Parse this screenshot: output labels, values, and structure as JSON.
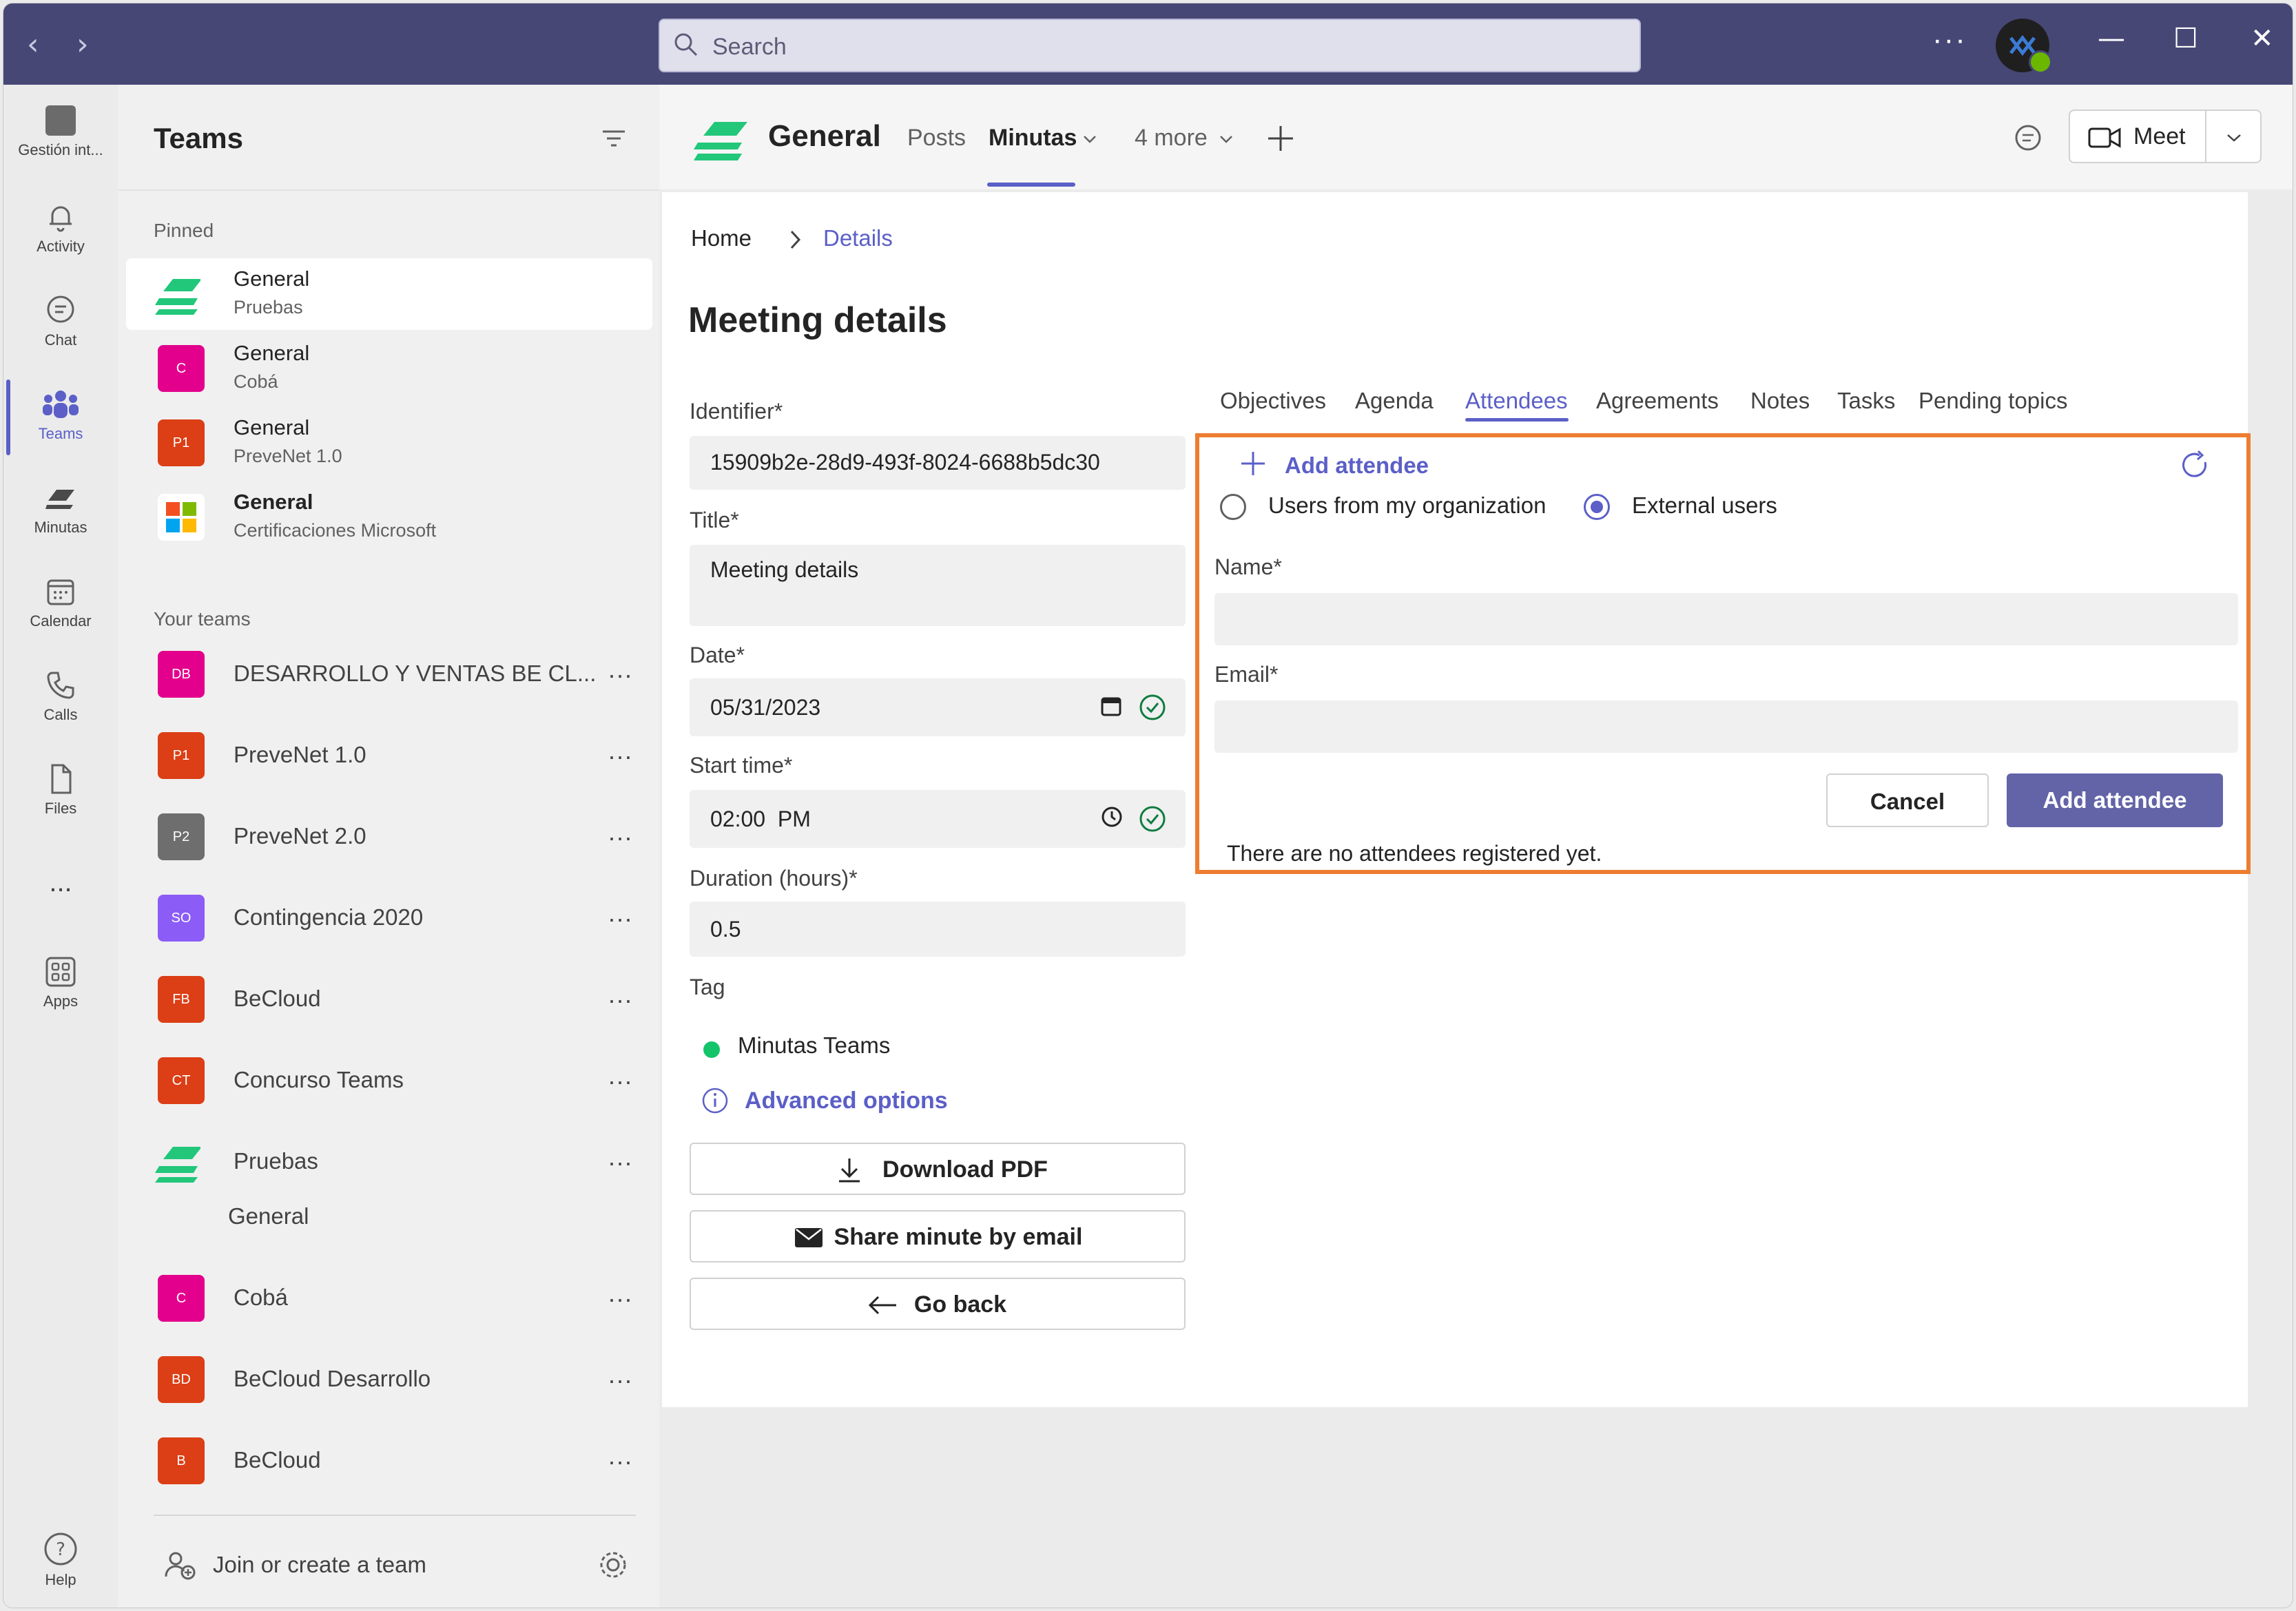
{
  "search": {
    "placeholder": "Search"
  },
  "rail": {
    "items": [
      {
        "label": "Gestión int..."
      },
      {
        "label": "Activity"
      },
      {
        "label": "Chat"
      },
      {
        "label": "Teams"
      },
      {
        "label": "Minutas"
      },
      {
        "label": "Calendar"
      },
      {
        "label": "Calls"
      },
      {
        "label": "Files"
      },
      {
        "label": "Apps"
      },
      {
        "label": "Help"
      }
    ],
    "more": "..."
  },
  "teams_panel": {
    "title": "Teams",
    "pinned_label": "Pinned",
    "pinned": [
      {
        "title": "General",
        "subtitle": "Pruebas",
        "icon": "minutas-logo",
        "selected": true
      },
      {
        "title": "General",
        "subtitle": "Cobá",
        "tile": "C",
        "color": "#e3008c"
      },
      {
        "title": "General",
        "subtitle": "PreveNet 1.0",
        "tile": "P1",
        "color": "#dc3e15"
      },
      {
        "title": "General",
        "subtitle": "Certificaciones Microsoft",
        "icon": "microsoft-logo"
      }
    ],
    "your_teams_label": "Your teams",
    "teams": [
      {
        "name": "DESARROLLO Y VENTAS BE CL...",
        "tile": "DB",
        "color": "#e3008c"
      },
      {
        "name": "PreveNet 1.0",
        "tile": "P1",
        "color": "#dc3e15"
      },
      {
        "name": "PreveNet 2.0",
        "tile": "P2",
        "color": "#6e6e6e"
      },
      {
        "name": "Contingencia 2020",
        "tile": "SO",
        "color": "#8b5cf6"
      },
      {
        "name": "BeCloud",
        "tile": "FB",
        "color": "#dc3e15"
      },
      {
        "name": "Concurso Teams",
        "tile": "CT",
        "color": "#dc3e15"
      },
      {
        "name": "Pruebas",
        "icon": "minutas-logo"
      },
      {
        "name": "Cobá",
        "tile": "C",
        "color": "#e3008c"
      },
      {
        "name": "BeCloud Desarrollo",
        "tile": "BD",
        "color": "#dc3e15"
      },
      {
        "name": "BeCloud",
        "tile": "B",
        "color": "#dc3e15"
      }
    ],
    "sub_channel": "General",
    "more_label": "...",
    "join_label": "Join or create a team"
  },
  "header": {
    "channel": "General",
    "tabs": [
      {
        "label": "Posts"
      },
      {
        "label": "Minutas"
      },
      {
        "label": "4 more"
      }
    ],
    "meet_label": "Meet"
  },
  "page": {
    "breadcrumb": {
      "home": "Home",
      "current": "Details"
    },
    "title": "Meeting details",
    "fields": {
      "identifier_label": "Identifier*",
      "identifier_value": "15909b2e-28d9-493f-8024-6688b5dc30",
      "title_label": "Title*",
      "title_value": "Meeting details",
      "date_label": "Date*",
      "date_value": "05/31/2023",
      "start_label": "Start time*",
      "start_value": "02:00  PM",
      "duration_label": "Duration (hours)*",
      "duration_value": "0.5",
      "tag_label": "Tag",
      "tag_value": "Minutas Teams"
    },
    "advanced_options": "Advanced options",
    "buttons": {
      "download": "Download PDF",
      "share": "Share minute by email",
      "back": "Go back"
    },
    "detail_tabs": [
      "Objectives",
      "Agenda",
      "Attendees",
      "Agreements",
      "Notes",
      "Tasks",
      "Pending topics"
    ],
    "attendees": {
      "add_link": "Add attendee",
      "radio_org": "Users from my organization",
      "radio_ext": "External users",
      "name_label": "Name*",
      "email_label": "Email*",
      "cancel": "Cancel",
      "add": "Add attendee",
      "empty": "There are no attendees registered yet."
    }
  },
  "colors": {
    "titlebar": "#464775",
    "accent": "#5b5fc7",
    "highlight": "#ed7d31"
  }
}
